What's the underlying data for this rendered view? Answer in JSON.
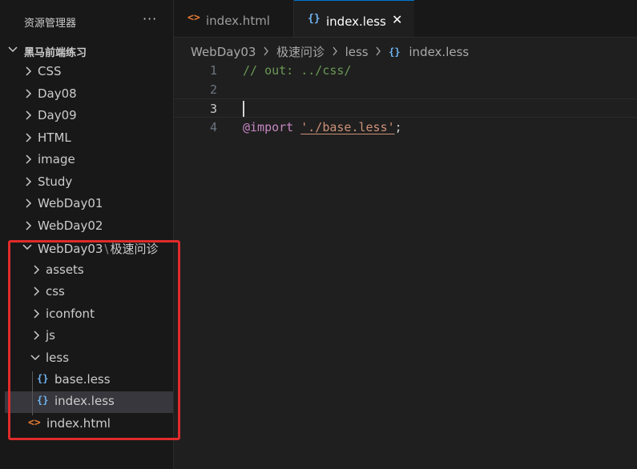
{
  "sidebar": {
    "title": "资源管理器",
    "more": "···",
    "root": "黑马前端练习",
    "items": [
      {
        "label": "CSS"
      },
      {
        "label": "Day08"
      },
      {
        "label": "Day09"
      },
      {
        "label": "HTML"
      },
      {
        "label": "image"
      },
      {
        "label": "Study"
      },
      {
        "label": "WebDay01"
      },
      {
        "label": "WebDay02"
      }
    ],
    "compact_folder": {
      "part1": "WebDay03",
      "sep": "\\",
      "part2": "极速问诊"
    },
    "subitems": [
      {
        "label": "assets"
      },
      {
        "label": "css"
      },
      {
        "label": "iconfont"
      },
      {
        "label": "js"
      },
      {
        "label": "less"
      }
    ],
    "less_files": [
      {
        "label": "base.less"
      },
      {
        "label": "index.less"
      }
    ],
    "html_file": "index.html"
  },
  "tabs": [
    {
      "label": "index.html",
      "icon": "<>"
    },
    {
      "label": "index.less",
      "icon": "{}",
      "close": "✕"
    }
  ],
  "breadcrumb": {
    "part1": "WebDay03",
    "part2": "极速问诊",
    "part3": "less",
    "part4": "index.less",
    "icon": "{}"
  },
  "editor": {
    "lines": [
      {
        "number": "1",
        "comment": "// out: ../css/"
      },
      {
        "number": "2"
      },
      {
        "number": "3"
      },
      {
        "number": "4",
        "at": "@import",
        "space": " ",
        "string": "'./base.less'",
        "semi": ";"
      }
    ]
  },
  "colors": {
    "accent": "#0078d4",
    "highlight_border": "#e02b2b",
    "less_icon": "#6fb3f0",
    "html_icon": "#e37933"
  }
}
